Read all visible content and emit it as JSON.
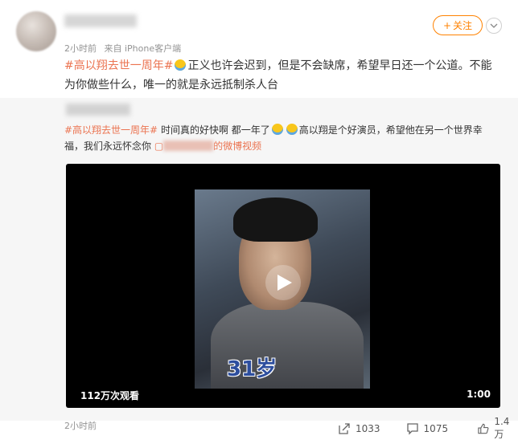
{
  "post": {
    "time": "2小时前",
    "source": "来自 iPhone客户端",
    "follow_label": "关注",
    "follow_plus": "+",
    "text": {
      "hashtag": "#高以翔去世一周年#",
      "body": "正义也许会迟到，但是不会缺席，希望早日还一个公道。不能为你做些什么，唯一的就是永远抵制杀人台"
    }
  },
  "repost": {
    "hashtag": "#高以翔去世一周年#",
    "body": " 时间真的好快啊 都一年了",
    "body2": "高以翔是个好演员，希望他在另一个世界幸福，我们永远怀念你 ",
    "link_suffix": "的微博视频",
    "video": {
      "overlay_text": "31岁",
      "views": "112万次观看",
      "duration": "1:00"
    },
    "time": "2小时前",
    "actions": {
      "repost_count": "1033",
      "comment_count": "1075",
      "like_count": "1.4万"
    }
  },
  "colors": {
    "accent": "#ff8200",
    "hashtag": "#eb7350",
    "meta": "#939393"
  }
}
